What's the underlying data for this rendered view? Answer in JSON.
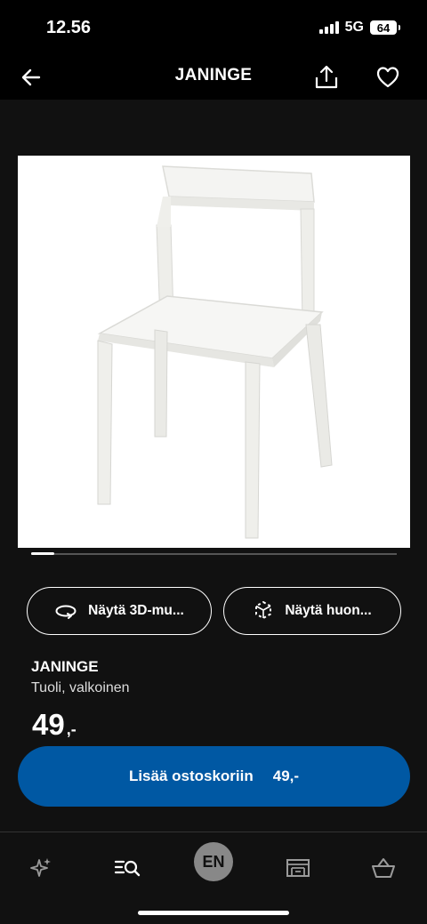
{
  "status": {
    "time": "12.56",
    "network": "5G",
    "battery": "64"
  },
  "nav": {
    "title": "JANINGE",
    "back_icon": "arrow-left-icon",
    "share_icon": "share-icon",
    "favorite_icon": "heart-icon"
  },
  "actions": {
    "view_3d": "Näytä 3D-mu...",
    "view_room": "Näytä huon..."
  },
  "product": {
    "name": "JANINGE",
    "description": "Tuoli, valkoinen",
    "price": "49",
    "price_suffix": ",-",
    "image_icon": "white-chair-image"
  },
  "carousel": {
    "current_index": 1
  },
  "cart_button": {
    "label": "Lisää ostoskoriin",
    "price": "49,-",
    "color": "#0058a3"
  },
  "tabs": {
    "discover_icon": "sparkle-icon",
    "search_icon": "search-list-icon",
    "language": "EN",
    "store_icon": "store-icon",
    "cart_icon": "basket-icon"
  }
}
